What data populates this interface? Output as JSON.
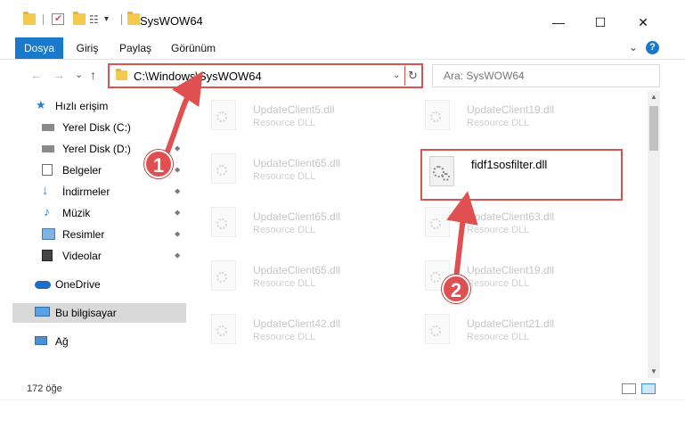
{
  "window": {
    "title": "SysWOW64",
    "controls": {
      "minimize": "—",
      "maximize": "☐",
      "close": "✕"
    }
  },
  "ribbon": {
    "tabs": [
      {
        "label": "Dosya",
        "active": true
      },
      {
        "label": "Giriş",
        "active": false
      },
      {
        "label": "Paylaş",
        "active": false
      },
      {
        "label": "Görünüm",
        "active": false
      }
    ],
    "expand_glyph": "⌄",
    "help_glyph": "?"
  },
  "nav": {
    "back": "←",
    "forward": "→",
    "recent": "⌄",
    "up": "↑",
    "address": "C:\\Windows\\SysWOW64",
    "address_dropdown": "⌄",
    "refresh": "↻",
    "search_placeholder": "Ara: SysWOW64"
  },
  "sidebar": {
    "items": [
      {
        "label": "Hızlı erişim",
        "icon": "star-icon",
        "pinned": false
      },
      {
        "label": "Yerel Disk (C:)",
        "icon": "drive-icon",
        "pinned": true
      },
      {
        "label": "Yerel Disk (D:)",
        "icon": "drive-icon",
        "pinned": true
      },
      {
        "label": "Belgeler",
        "icon": "documents-icon",
        "pinned": true
      },
      {
        "label": "İndirmeler",
        "icon": "download-icon",
        "pinned": true
      },
      {
        "label": "Müzik",
        "icon": "music-icon",
        "pinned": true
      },
      {
        "label": "Resimler",
        "icon": "pictures-icon",
        "pinned": true
      },
      {
        "label": "Videolar",
        "icon": "videos-icon",
        "pinned": true
      },
      {
        "label": "OneDrive",
        "icon": "cloud-icon",
        "pinned": false
      },
      {
        "label": "Bu bilgisayar",
        "icon": "computer-icon",
        "pinned": false,
        "selected": true
      },
      {
        "label": "Ağ",
        "icon": "network-icon",
        "pinned": false
      }
    ],
    "pin_glyph": "📌"
  },
  "files": [
    {
      "name": "UpdateClient5.dll",
      "type": "Resource DLL"
    },
    {
      "name": "UpdateClient19.dll",
      "type": "Resource DLL"
    },
    {
      "name": "UpdateClient65.dll",
      "type": "Resource DLL"
    },
    {
      "name": "fidf1sosfilter.dll",
      "type": ""
    },
    {
      "name": "UpdateClient65.dll",
      "type": "Resource DLL"
    },
    {
      "name": "UpdateClient63.dll",
      "type": "Resource DLL"
    },
    {
      "name": "UpdateClient65.dll",
      "type": "Resource DLL"
    },
    {
      "name": "UpdateClient19.dll",
      "type": "Resource DLL"
    },
    {
      "name": "UpdateClient42.dll",
      "type": "Resource DLL"
    },
    {
      "name": "UpdateClient21.dll",
      "type": "Resource DLL"
    }
  ],
  "status": {
    "item_count": "172 öğe"
  },
  "callouts": {
    "one": "1",
    "two": "2"
  },
  "colors": {
    "accent": "#1979ca",
    "highlight": "#d9534f",
    "callout": "#e05050"
  }
}
